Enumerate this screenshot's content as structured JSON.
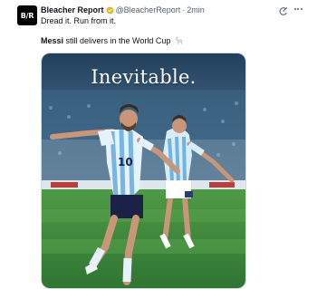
{
  "post": {
    "author_name": "Bleacher Report",
    "handle": "@BleacherReport",
    "separator": "·",
    "time": "2min",
    "avatar_text": "B/R",
    "reply_text": "Dread it. Run from it.",
    "caption_bold": "Messi",
    "caption_rest": " still delivers in the World Cup",
    "caption_emoji": "goat-icon",
    "media_overlay_text": "Inevitable."
  },
  "icons": {
    "verified": "verified-badge-icon",
    "grok": "grok-icon",
    "more": "more-options-icon"
  },
  "colors": {
    "verified": "#e2b719",
    "text": "#0f1419",
    "secondary": "#536471",
    "pitch": "#3f8a3e",
    "stadium": "#1d3550"
  }
}
